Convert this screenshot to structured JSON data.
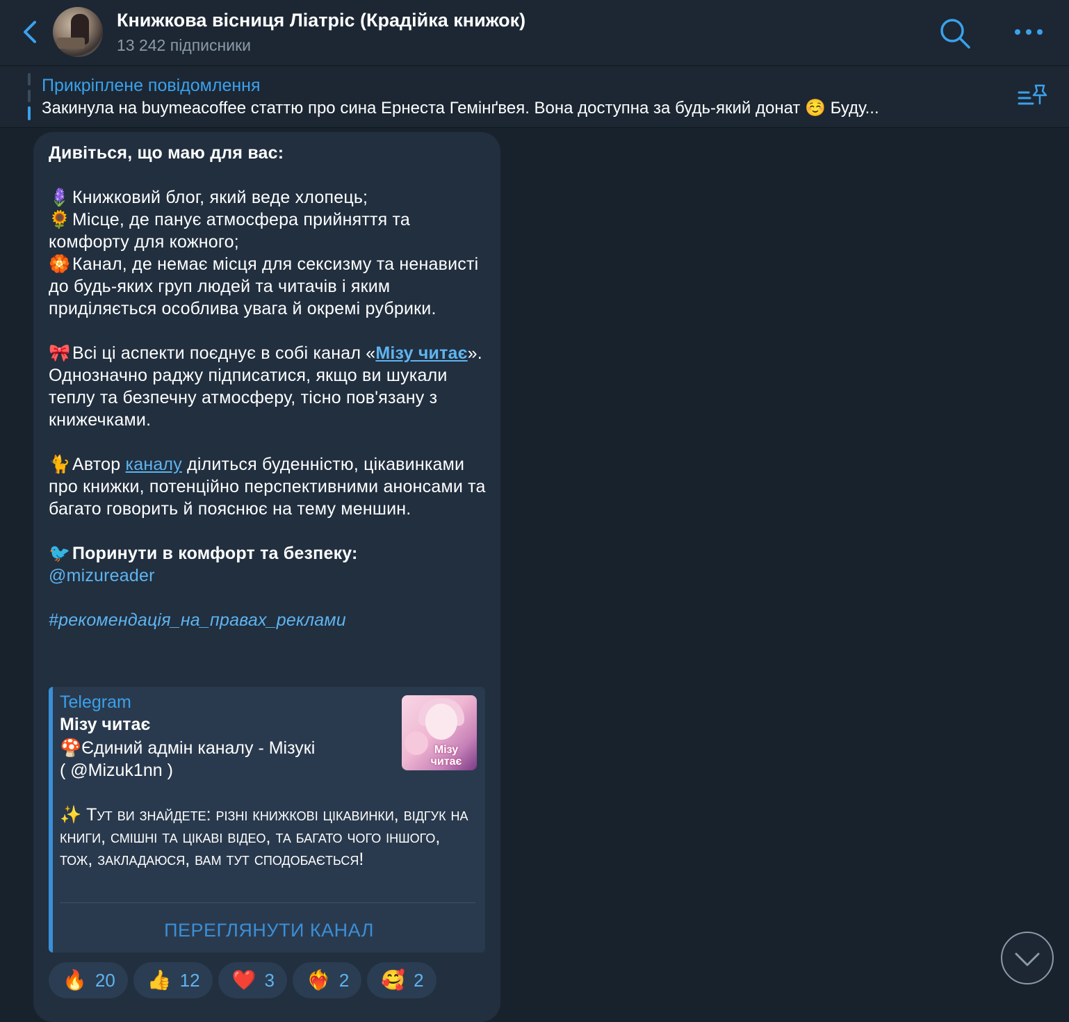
{
  "header": {
    "title": "Книжкова вісниця Ліатріс (Крадійка книжок)",
    "subtitle": "13 242 підписники"
  },
  "pinned": {
    "title": "Прикріплене повідомлення",
    "text": "Закинула на buymeacoffee статтю про сина Ернеста Гемінґвея.  Вона доступна за будь-який донат ☺️ Буду..."
  },
  "message": {
    "heading": "Дивіться, що маю для вас:",
    "item1_emoji": "🪻",
    "item1": "Книжковий блог, який веде хлопець;",
    "item2_emoji": "🌻",
    "item2": "Місце, де панує атмосфера прийняття та комфорту для кожного;",
    "item3_emoji": "🏵️",
    "item3": "Канал, де немає місця для сексизму та ненависті до будь-яких груп людей та читачів і яким приділяється особлива увага й окремі рубрики.",
    "p2_emoji": "🎀",
    "p2_before": "Всі ці аспекти поєднує в собі канал «",
    "p2_link": "Мізу читає",
    "p2_after": "». Однозначно раджу підписатися, якщо ви шукали теплу та безпечну атмосферу, тісно пов'язану з книжечками.",
    "p3_emoji": "🐈",
    "p3_before": "Автор ",
    "p3_link": "каналу",
    "p3_after": " ділиться буденністю, цікавинками про книжки, потенційно перспективними анонсами та багато говорить й пояснює на тему меншин.",
    "p4_emoji": "🐦",
    "p4_bold": "Поринути в комфорт та безпеку:",
    "mention": "@mizureader",
    "hashtag": "#рекомендація_на_правах_реклами"
  },
  "preview": {
    "site": "Telegram",
    "title": "Мізу читає",
    "line1_emoji": "🍄",
    "line1": "Єдиний адмін каналу - Мізукі",
    "line2": "( @Mizuk1nn )",
    "line3_emoji": "✨",
    "line3": "Тут ви знайдете: різні книжкові цікавинки, відгук на книги, смішні та цікаві відео, та багато чого іншого, тож, закладаюся, вам тут сподобається!",
    "thumb_label": "Мізу читає",
    "button": "ПЕРЕГЛЯНУТИ КАНАЛ"
  },
  "reactions": [
    {
      "emoji": "🔥",
      "count": "20"
    },
    {
      "emoji": "👍",
      "count": "12"
    },
    {
      "emoji": "❤️",
      "count": "3"
    },
    {
      "emoji": "❤️‍🔥",
      "count": "2"
    },
    {
      "emoji": "🥰",
      "count": "2"
    }
  ],
  "colors": {
    "accent": "#3ba1ec",
    "background": "#18222d",
    "bubble": "#212f3f",
    "header": "#1c2733"
  }
}
